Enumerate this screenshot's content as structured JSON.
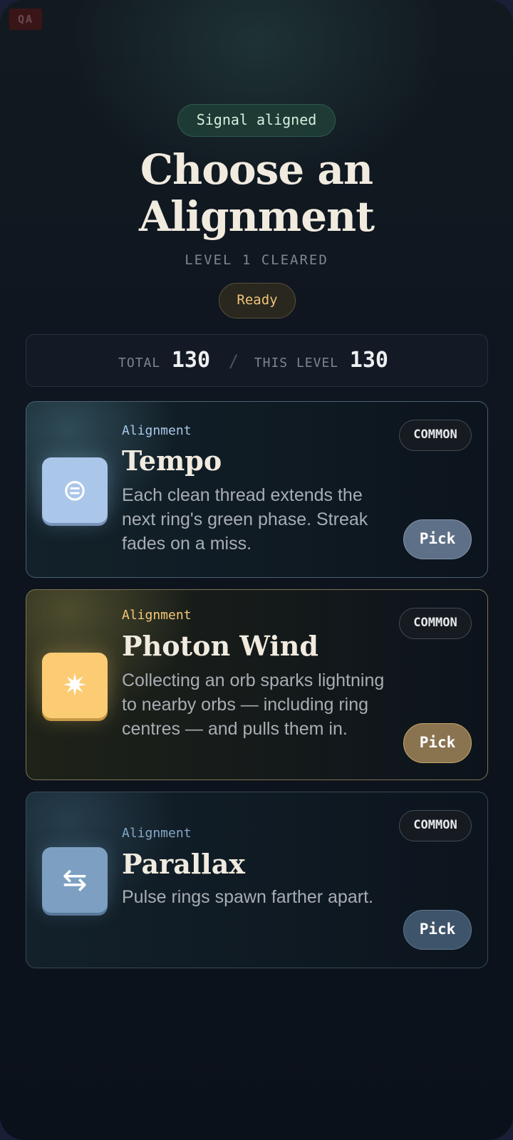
{
  "debug_badge": "QA",
  "header": {
    "status_pill": "Signal aligned",
    "title_line1": "Choose an",
    "title_line2": "Alignment",
    "subtitle": "LEVEL 1 CLEARED",
    "ready_pill": "Ready"
  },
  "score": {
    "total_label": "TOTAL",
    "total_value": "130",
    "separator": "/",
    "level_label": "THIS LEVEL",
    "level_value": "130"
  },
  "cards": [
    {
      "kicker": "Alignment",
      "name": "Tempo",
      "description": "Each clean thread extends the next ring's green phase. Streak fades on a miss.",
      "rarity": "COMMON",
      "pick_label": "Pick",
      "icon": "tempo-icon",
      "icon_glyph": "⊜",
      "accent": "#aac6e9"
    },
    {
      "kicker": "Alignment",
      "name": "Photon Wind",
      "description": "Collecting an orb sparks lightning to nearby orbs — including ring centres — and pulls them in.",
      "rarity": "COMMON",
      "pick_label": "Pick",
      "icon": "sun-spark-icon",
      "icon_glyph": "✷",
      "accent": "#fccc74"
    },
    {
      "kicker": "Alignment",
      "name": "Parallax",
      "description": "Pulse rings spawn farther apart.",
      "rarity": "COMMON",
      "pick_label": "Pick",
      "icon": "swap-arrows-icon",
      "icon_glyph": "⇆",
      "accent": "#7da0c2"
    }
  ]
}
